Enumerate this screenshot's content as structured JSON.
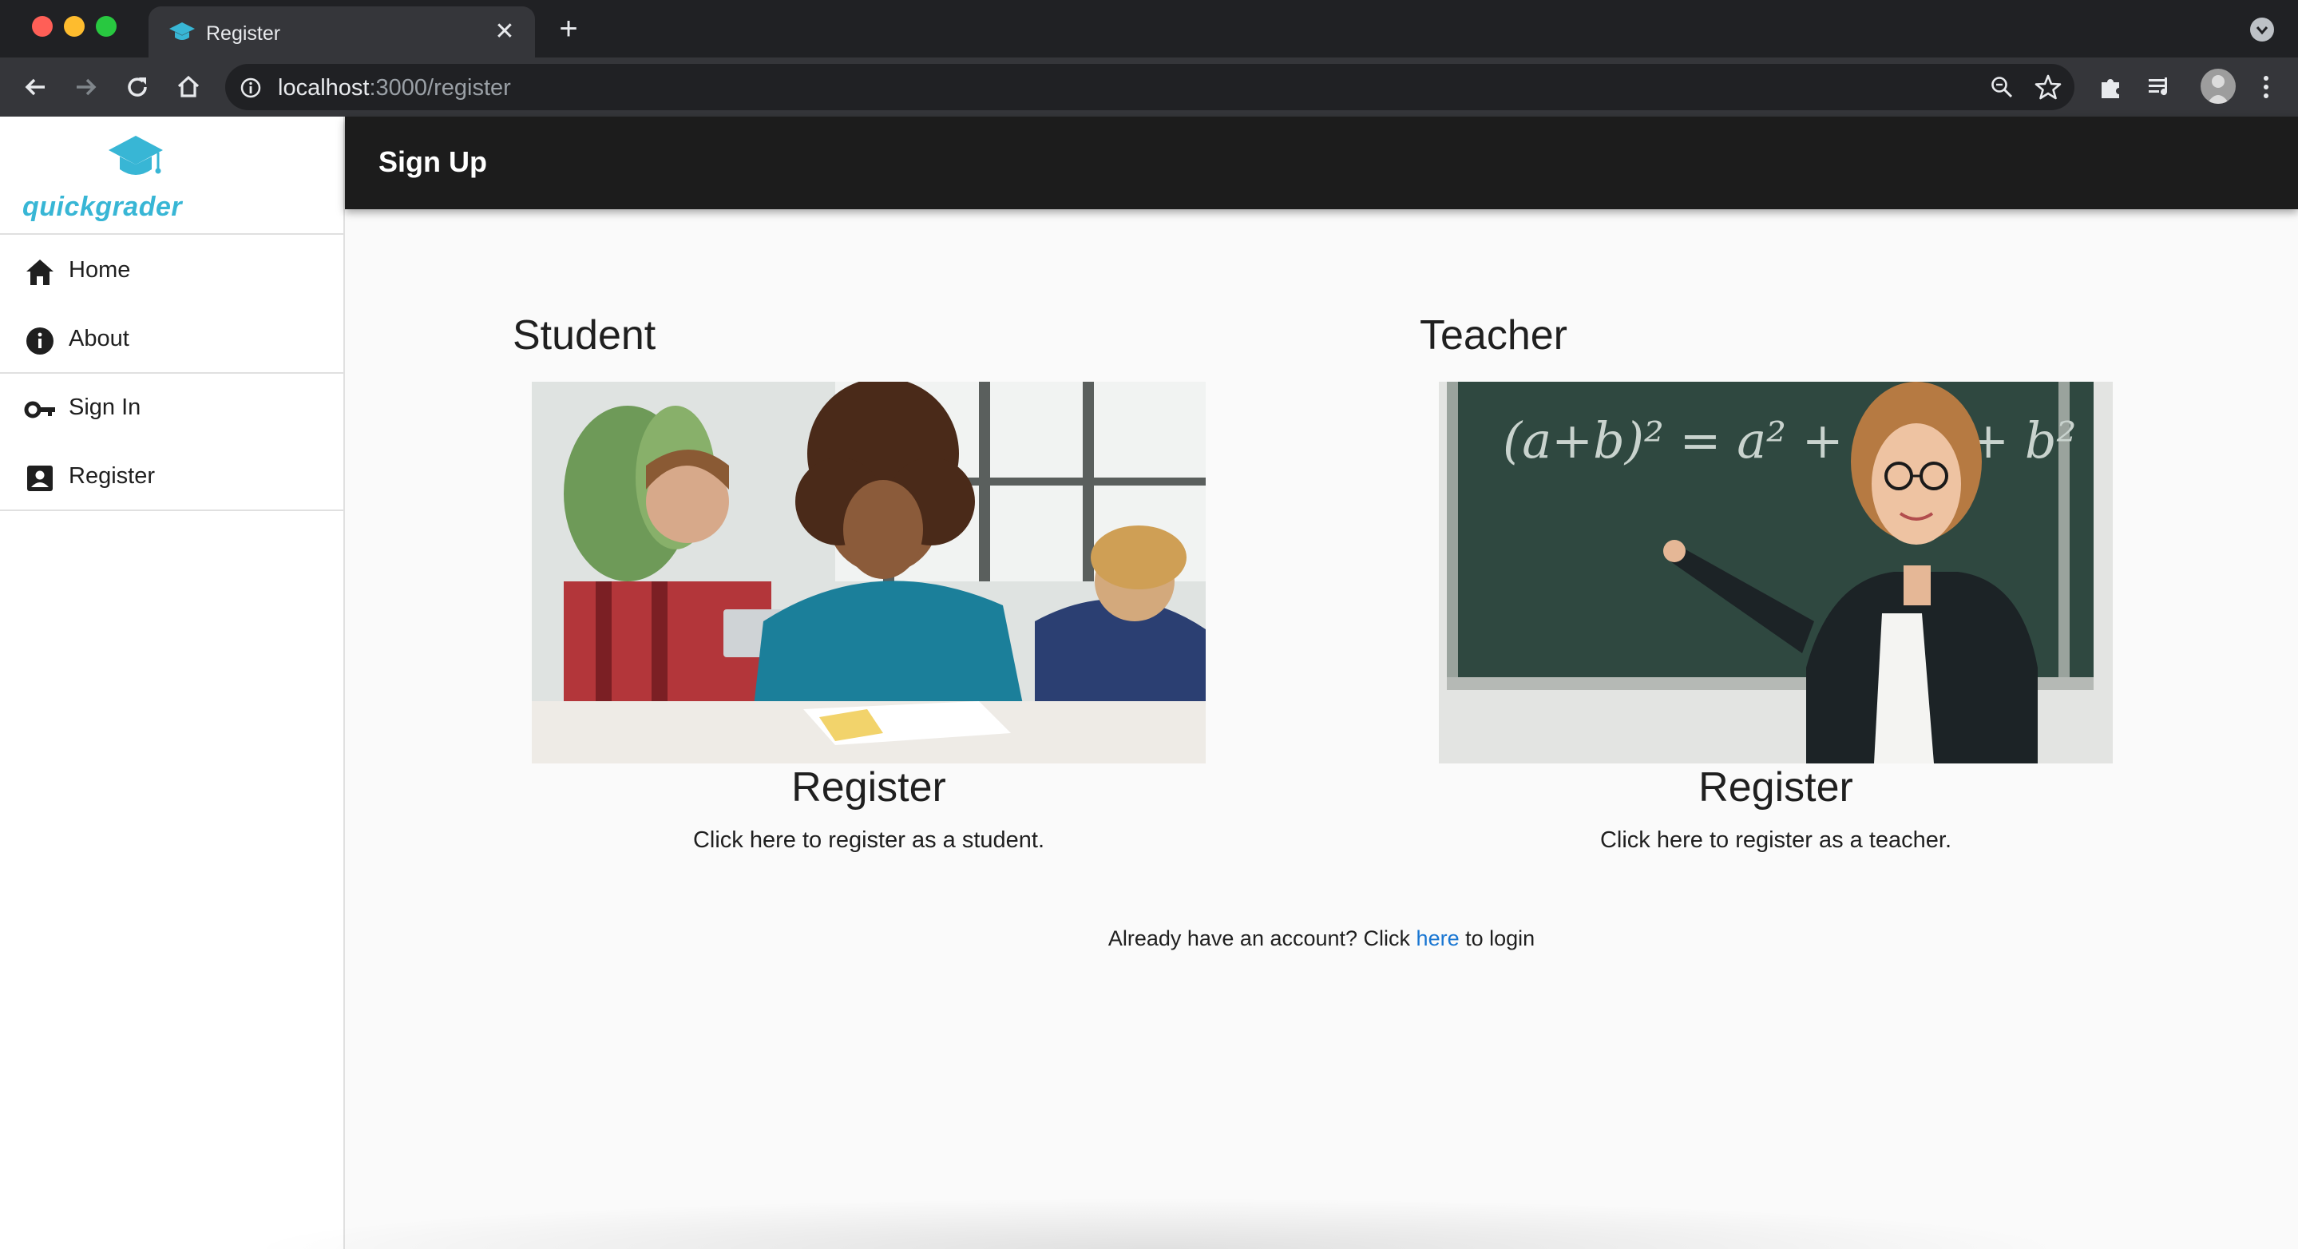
{
  "browser": {
    "tab": {
      "title": "Register",
      "close_glyph": "✕"
    },
    "new_tab_glyph": "+",
    "url_host": "localhost",
    "url_path": ":3000/register",
    "icons": [
      "back-icon",
      "forward-icon",
      "reload-icon",
      "home-icon",
      "info-icon",
      "zoom-icon",
      "star-icon",
      "extensions-icon",
      "media-icon",
      "avatar",
      "menu-icon"
    ]
  },
  "sidebar": {
    "logo_text": "quickgrader",
    "brand_color": "#38b6d5",
    "items": [
      {
        "label": "Home",
        "icon": "home-icon"
      },
      {
        "label": "About",
        "icon": "info-icon"
      },
      {
        "label": "Sign In",
        "icon": "key-icon"
      },
      {
        "label": "Register",
        "icon": "account-box-icon"
      }
    ]
  },
  "appbar": {
    "title": "Sign Up"
  },
  "cards": [
    {
      "heading": "Student",
      "action": "Register",
      "description": "Click here to register as a student.",
      "image": "photo of students writing at desks"
    },
    {
      "heading": "Teacher",
      "action": "Register",
      "description": "Click here to register as a teacher.",
      "image": "photo of teacher at chalkboard",
      "chalk_formula": "(a+b)² = a² + 2ab + b²"
    }
  ],
  "login": {
    "prefix": "Already have an account? Click ",
    "link": "here",
    "suffix": " to login",
    "link_color": "#1976d2"
  }
}
